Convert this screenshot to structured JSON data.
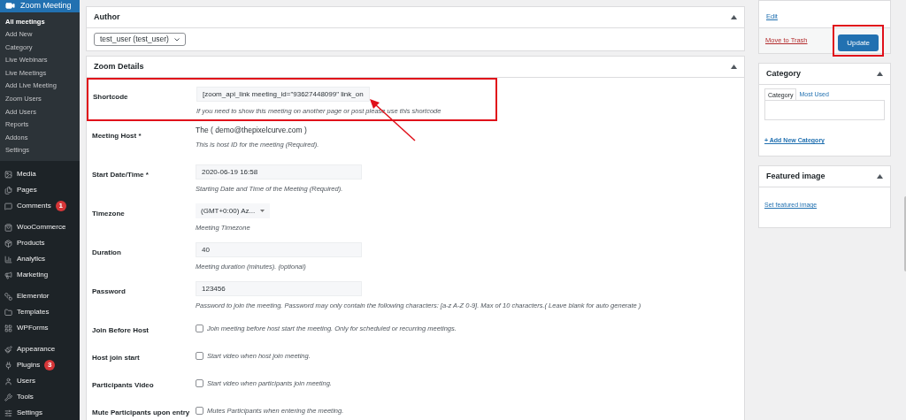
{
  "sidebar": {
    "menu": {
      "label": "Zoom Meeting",
      "selected": true,
      "children": [
        {
          "label": "All meetings",
          "selected": true
        },
        {
          "label": "Add New",
          "selected": false
        },
        {
          "label": "Category",
          "selected": false
        },
        {
          "label": "Live Webinars",
          "selected": false
        },
        {
          "label": "Live Meetings",
          "selected": false
        },
        {
          "label": "Add Live Meeting",
          "selected": false
        },
        {
          "label": "Zoom Users",
          "selected": false
        },
        {
          "label": "Add Users",
          "selected": false
        },
        {
          "label": "Reports",
          "selected": false
        },
        {
          "label": "Addons",
          "selected": false
        },
        {
          "label": "Settings",
          "selected": false
        }
      ]
    },
    "groups": [
      [
        {
          "label": "Media"
        },
        {
          "label": "Pages"
        },
        {
          "label": "Comments",
          "badge": "1"
        }
      ],
      [
        {
          "label": "WooCommerce"
        },
        {
          "label": "Products"
        },
        {
          "label": "Analytics"
        },
        {
          "label": "Marketing"
        }
      ],
      [
        {
          "label": "Elementor"
        },
        {
          "label": "Templates"
        },
        {
          "label": "WPForms"
        }
      ],
      [
        {
          "label": "Appearance"
        },
        {
          "label": "Plugins",
          "badge": "3"
        },
        {
          "label": "Users"
        },
        {
          "label": "Tools"
        },
        {
          "label": "Settings"
        }
      ]
    ]
  },
  "author_box": {
    "title": "Author",
    "value": "test_user (test_user)"
  },
  "details_box": {
    "title": "Zoom Details",
    "rows": [
      {
        "label": "Shortcode",
        "kind": "input",
        "value": "[zoom_api_link meeting_id=\"93627448099\" link_on",
        "description": "If you need to show this meeting on another page or post please use this shortcode",
        "highlighted": true
      },
      {
        "label": "Meeting Host *",
        "kind": "text",
        "value": "The ( demo@thepixelcurve.com )",
        "description": "This is host ID for the meeting (Required).",
        "highlighted": false
      },
      {
        "label": "Start Date/Time *",
        "kind": "input",
        "value": "2020-06-19 16:58",
        "description": "Starting Date and Time of the Meeting (Required).",
        "highlighted": false
      },
      {
        "label": "Timezone",
        "kind": "select",
        "value": "(GMT+0:00) Az...",
        "description": "Meeting Timezone",
        "highlighted": false
      },
      {
        "label": "Duration",
        "kind": "input",
        "value": "40",
        "description": "Meeting duration (minutes). (optional)",
        "highlighted": false
      },
      {
        "label": "Password",
        "kind": "input",
        "value": "123456",
        "description": "Password to join the meeting. Password may only contain the following characters: [a-z A-Z 0-9]. Max of 10 characters.( Leave blank for auto generate )",
        "highlighted": false
      },
      {
        "label": "Join Before Host",
        "kind": "checkbox",
        "checked": false,
        "description": "Join meeting before host start the meeting. Only for scheduled or recurring meetings.",
        "highlighted": false
      },
      {
        "label": "Host join start",
        "kind": "checkbox",
        "checked": false,
        "description": "Start video when host join meeting.",
        "highlighted": false
      },
      {
        "label": "Participants Video",
        "kind": "checkbox",
        "checked": false,
        "description": "Start video when participants join meeting.",
        "highlighted": false
      },
      {
        "label": "Mute Participants upon entry",
        "kind": "checkbox",
        "checked": false,
        "description": "Mutes Participants when entering the meeting.",
        "highlighted": false
      }
    ]
  },
  "publish_box": {
    "edit_link": "Edit",
    "trash_link": "Move to Trash",
    "update_button": "Update",
    "update_highlighted": true
  },
  "category_box": {
    "title": "Category",
    "tabs": [
      {
        "label": "Category",
        "selected": true
      },
      {
        "label": "Most Used",
        "selected": false
      }
    ],
    "add_link": "+ Add New Category"
  },
  "featured_box": {
    "title": "Featured image",
    "link": "Set featured image"
  }
}
